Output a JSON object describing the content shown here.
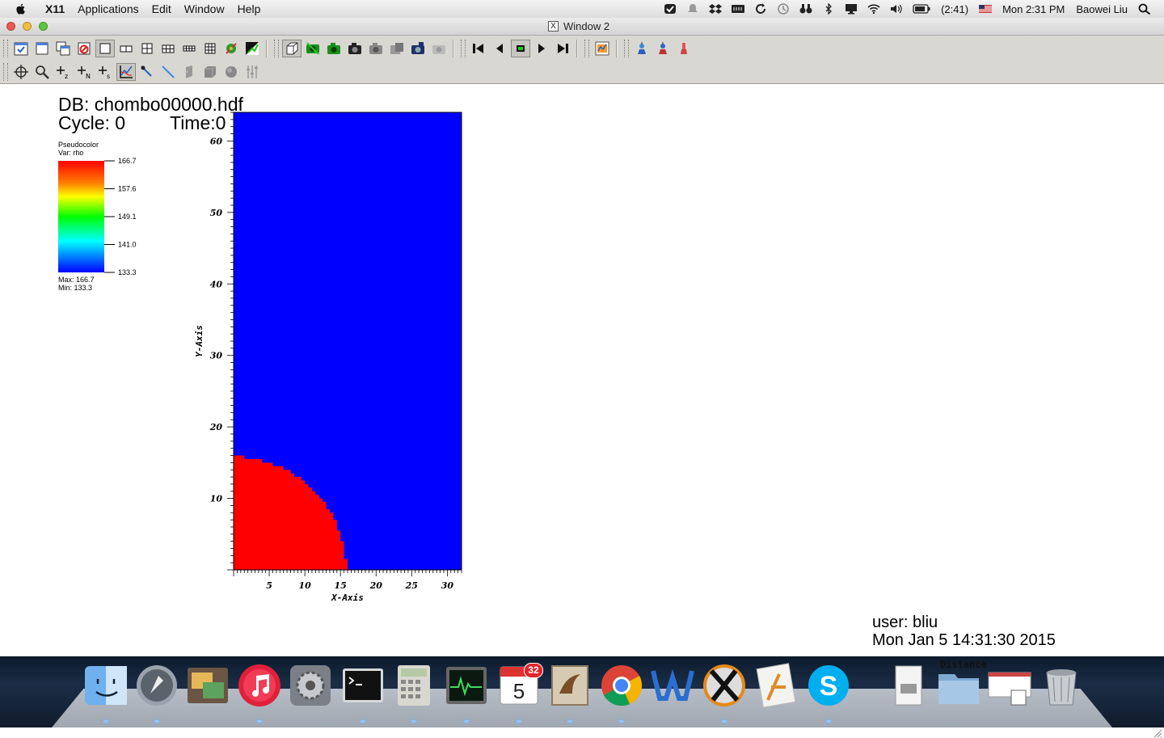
{
  "menubar": {
    "app_name": "X11",
    "items": [
      "Applications",
      "Edit",
      "Window",
      "Help"
    ],
    "battery": "(2:41)",
    "clock": "Mon 2:31 PM",
    "user": "Baowei Liu"
  },
  "window": {
    "title": "Window 2"
  },
  "toolbar1": {
    "buttons": [
      "clear-active-window-icon",
      "new-window-icon",
      "clone-window-icon",
      "delete-window-icon",
      "layout-1x1-icon",
      "layout-1x2-icon",
      "layout-2x2-icon",
      "layout-2x3-icon",
      "layout-2x4-icon",
      "layout-3x3-icon",
      "lock-view-icon",
      "invert-icon",
      "navigate-3d-icon",
      "hide-active-plot-icon",
      "show-plots-icon",
      "draw-plots-icon",
      "save-image-icon",
      "print-icon",
      "copy-icon",
      "paste-icon",
      "rewind-icon",
      "step-back-icon",
      "stop-icon",
      "step-forward-icon",
      "play-icon",
      "pick-icon",
      "recenter-icon",
      "undo-view-icon",
      "redo-view-icon"
    ]
  },
  "toolbar2": {
    "buttons": [
      "navigate-icon",
      "zoom-icon",
      "zone-pick-icon",
      "node-pick-icon",
      "spreadsheet-pick-icon",
      "lineout-icon",
      "point-tool-icon",
      "line-tool-icon",
      "plane-tool-icon",
      "box-tool-icon",
      "sphere-tool-icon",
      "axis-restrict-icon"
    ]
  },
  "annotations": {
    "db": "DB: chombo00000.hdf",
    "cycle": "Cycle: 0",
    "time": "Time:0",
    "user": "user: bliu",
    "date": "Mon Jan  5 14:31:30 2015"
  },
  "legend": {
    "type_label": "Pseudocolor",
    "var_label": "Var: rho",
    "ticks": [
      "166.7",
      "157.6",
      "149.1",
      "141.0",
      "133.3"
    ],
    "max_label": "Max:  166.7",
    "min_label": "Min:  133.3"
  },
  "chart_data": {
    "type": "heatmap",
    "variable": "rho",
    "xlabel": "X-Axis",
    "ylabel": "Y-Axis",
    "xlim": [
      0,
      32
    ],
    "ylim": [
      0,
      64
    ],
    "xticks": [
      5,
      10,
      15,
      20,
      25,
      30
    ],
    "yticks": [
      10,
      20,
      30,
      40,
      50,
      60
    ],
    "regions": [
      {
        "name": "background",
        "value": 133.3,
        "color": "#0000ff"
      },
      {
        "name": "quarter-disk",
        "shape": "circle",
        "center": [
          0,
          0
        ],
        "radius": 15.8,
        "value": 166.7,
        "color": "#ff0000"
      }
    ],
    "colors": {
      "min": "#0000ff",
      "max": "#ff0000"
    }
  },
  "dock": {
    "apps": [
      "Finder",
      "Launchpad",
      "Image Capture",
      "iTunes",
      "System Preferences",
      "Terminal",
      "Calculator",
      "Activity Monitor",
      "Calendar",
      "Mail",
      "Google Chrome",
      "Word",
      "X11",
      "Xcode",
      "Skype",
      "Documents",
      "Distance folder",
      "Calendar stack",
      "Trash"
    ],
    "calendar_badge": "32",
    "folder_label": "Distance"
  }
}
